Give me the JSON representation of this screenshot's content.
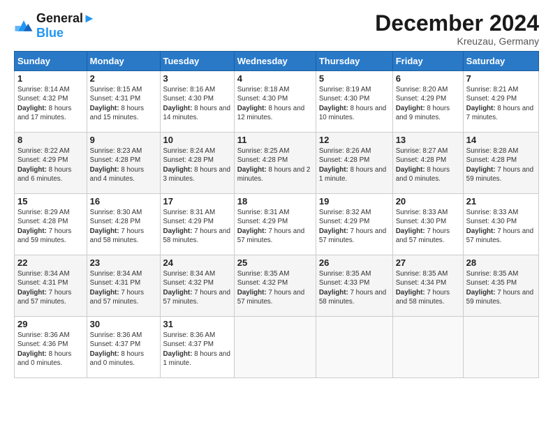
{
  "logo": {
    "line1": "General",
    "line2": "Blue"
  },
  "title": "December 2024",
  "subtitle": "Kreuzau, Germany",
  "days_of_week": [
    "Sunday",
    "Monday",
    "Tuesday",
    "Wednesday",
    "Thursday",
    "Friday",
    "Saturday"
  ],
  "weeks": [
    [
      {
        "day": 1,
        "info": "Sunrise: 8:14 AM\nSunset: 4:32 PM\nDaylight: 8 hours and 17 minutes."
      },
      {
        "day": 2,
        "info": "Sunrise: 8:15 AM\nSunset: 4:31 PM\nDaylight: 8 hours and 15 minutes."
      },
      {
        "day": 3,
        "info": "Sunrise: 8:16 AM\nSunset: 4:30 PM\nDaylight: 8 hours and 14 minutes."
      },
      {
        "day": 4,
        "info": "Sunrise: 8:18 AM\nSunset: 4:30 PM\nDaylight: 8 hours and 12 minutes."
      },
      {
        "day": 5,
        "info": "Sunrise: 8:19 AM\nSunset: 4:30 PM\nDaylight: 8 hours and 10 minutes."
      },
      {
        "day": 6,
        "info": "Sunrise: 8:20 AM\nSunset: 4:29 PM\nDaylight: 8 hours and 9 minutes."
      },
      {
        "day": 7,
        "info": "Sunrise: 8:21 AM\nSunset: 4:29 PM\nDaylight: 8 hours and 7 minutes."
      }
    ],
    [
      {
        "day": 8,
        "info": "Sunrise: 8:22 AM\nSunset: 4:29 PM\nDaylight: 8 hours and 6 minutes."
      },
      {
        "day": 9,
        "info": "Sunrise: 8:23 AM\nSunset: 4:28 PM\nDaylight: 8 hours and 4 minutes."
      },
      {
        "day": 10,
        "info": "Sunrise: 8:24 AM\nSunset: 4:28 PM\nDaylight: 8 hours and 3 minutes."
      },
      {
        "day": 11,
        "info": "Sunrise: 8:25 AM\nSunset: 4:28 PM\nDaylight: 8 hours and 2 minutes."
      },
      {
        "day": 12,
        "info": "Sunrise: 8:26 AM\nSunset: 4:28 PM\nDaylight: 8 hours and 1 minute."
      },
      {
        "day": 13,
        "info": "Sunrise: 8:27 AM\nSunset: 4:28 PM\nDaylight: 8 hours and 0 minutes."
      },
      {
        "day": 14,
        "info": "Sunrise: 8:28 AM\nSunset: 4:28 PM\nDaylight: 7 hours and 59 minutes."
      }
    ],
    [
      {
        "day": 15,
        "info": "Sunrise: 8:29 AM\nSunset: 4:28 PM\nDaylight: 7 hours and 59 minutes."
      },
      {
        "day": 16,
        "info": "Sunrise: 8:30 AM\nSunset: 4:28 PM\nDaylight: 7 hours and 58 minutes."
      },
      {
        "day": 17,
        "info": "Sunrise: 8:31 AM\nSunset: 4:29 PM\nDaylight: 7 hours and 58 minutes."
      },
      {
        "day": 18,
        "info": "Sunrise: 8:31 AM\nSunset: 4:29 PM\nDaylight: 7 hours and 57 minutes."
      },
      {
        "day": 19,
        "info": "Sunrise: 8:32 AM\nSunset: 4:29 PM\nDaylight: 7 hours and 57 minutes."
      },
      {
        "day": 20,
        "info": "Sunrise: 8:33 AM\nSunset: 4:30 PM\nDaylight: 7 hours and 57 minutes."
      },
      {
        "day": 21,
        "info": "Sunrise: 8:33 AM\nSunset: 4:30 PM\nDaylight: 7 hours and 57 minutes."
      }
    ],
    [
      {
        "day": 22,
        "info": "Sunrise: 8:34 AM\nSunset: 4:31 PM\nDaylight: 7 hours and 57 minutes."
      },
      {
        "day": 23,
        "info": "Sunrise: 8:34 AM\nSunset: 4:31 PM\nDaylight: 7 hours and 57 minutes."
      },
      {
        "day": 24,
        "info": "Sunrise: 8:34 AM\nSunset: 4:32 PM\nDaylight: 7 hours and 57 minutes."
      },
      {
        "day": 25,
        "info": "Sunrise: 8:35 AM\nSunset: 4:32 PM\nDaylight: 7 hours and 57 minutes."
      },
      {
        "day": 26,
        "info": "Sunrise: 8:35 AM\nSunset: 4:33 PM\nDaylight: 7 hours and 58 minutes."
      },
      {
        "day": 27,
        "info": "Sunrise: 8:35 AM\nSunset: 4:34 PM\nDaylight: 7 hours and 58 minutes."
      },
      {
        "day": 28,
        "info": "Sunrise: 8:35 AM\nSunset: 4:35 PM\nDaylight: 7 hours and 59 minutes."
      }
    ],
    [
      {
        "day": 29,
        "info": "Sunrise: 8:36 AM\nSunset: 4:36 PM\nDaylight: 8 hours and 0 minutes."
      },
      {
        "day": 30,
        "info": "Sunrise: 8:36 AM\nSunset: 4:37 PM\nDaylight: 8 hours and 0 minutes."
      },
      {
        "day": 31,
        "info": "Sunrise: 8:36 AM\nSunset: 4:37 PM\nDaylight: 8 hours and 1 minute."
      },
      null,
      null,
      null,
      null
    ]
  ]
}
